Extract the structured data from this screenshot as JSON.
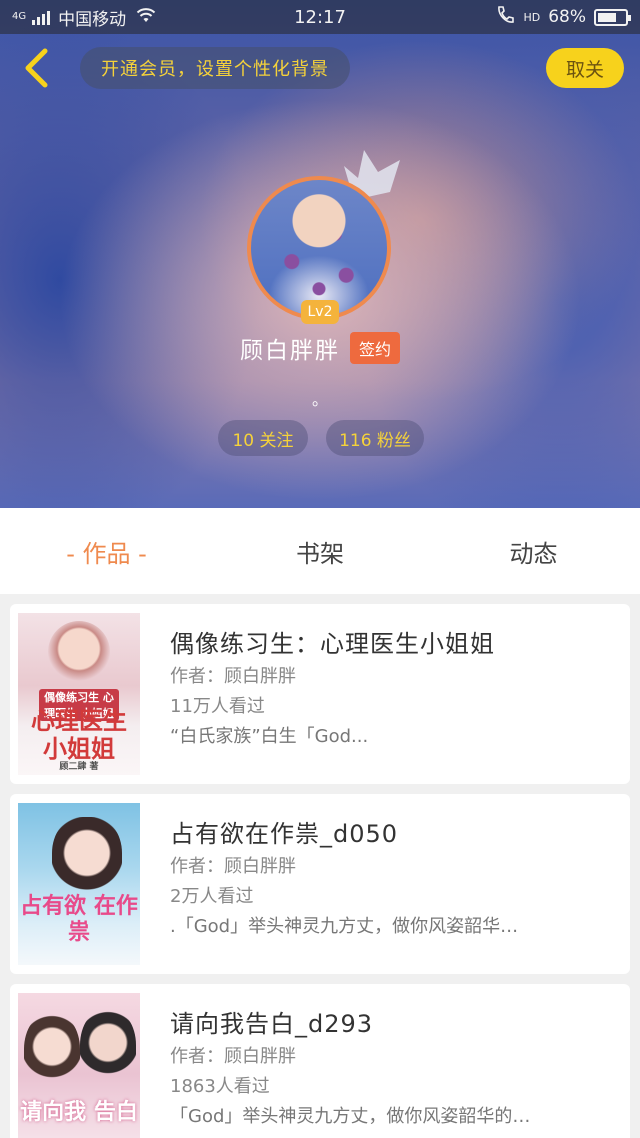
{
  "status_bar": {
    "network": "4G",
    "carrier": "中国移动",
    "time": "12:17",
    "hd": "HD",
    "battery_text": "68%",
    "battery_level": 0.68
  },
  "header": {
    "back_icon": "chevron-left-icon",
    "vip_banner": "开通会员，设置个性化背景",
    "unfollow_label": "取关",
    "avatar_level": "Lv2",
    "username": "顾白胖胖",
    "signed_badge": "签约",
    "signature": "。",
    "following": "10 关注",
    "followers": "116 粉丝"
  },
  "tabs": [
    {
      "label": "- 作品 -",
      "active": true
    },
    {
      "label": "书架",
      "active": false
    },
    {
      "label": "动态",
      "active": false
    }
  ],
  "works": [
    {
      "title": "偶像练习生：心理医生小姐姐",
      "author": "作者：顾白胖胖",
      "views": "11万人看过",
      "desc": "“白氏家族”白生「God...",
      "cover_text": "偶像练习生 心理医生 小姐姐",
      "cover_caption": "顾二肆 著"
    },
    {
      "title": "占有欲在作祟_d050",
      "author": "作者：顾白胖胖",
      "views": "2万人看过",
      "desc": ".「God」举头神灵九方丈，做你风姿韶华…",
      "cover_text": "占有欲 在作祟"
    },
    {
      "title": "请向我告白_d293",
      "author": "作者：顾白胖胖",
      "views": "1863人看过",
      "desc": "「God」举头神灵九方丈，做你风姿韶华的…",
      "cover_text": "请向我 告白"
    }
  ],
  "colors": {
    "accent": "#ef8a4e",
    "yellow": "#f7d21c",
    "gold_text": "#f5d23a"
  }
}
